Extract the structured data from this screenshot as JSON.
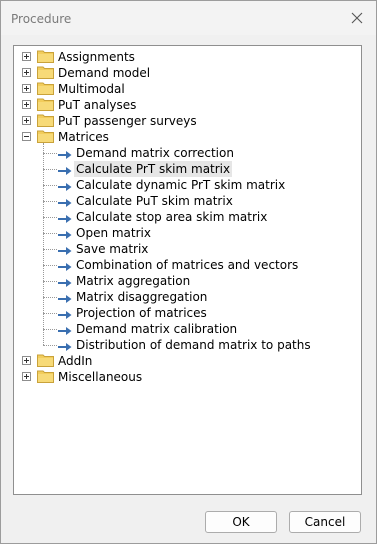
{
  "window": {
    "title": "Procedure"
  },
  "tree": {
    "folders_top": [
      "Assignments",
      "Demand model",
      "Multimodal",
      "PuT analyses",
      "PuT passenger surveys"
    ],
    "expanded_folder": "Matrices",
    "children": [
      "Demand matrix correction",
      "Calculate PrT skim matrix",
      "Calculate dynamic PrT skim matrix",
      "Calculate PuT skim matrix",
      "Calculate stop area skim matrix",
      "Open matrix",
      "Save matrix",
      "Combination of matrices and vectors",
      "Matrix aggregation",
      "Matrix disaggregation",
      "Projection of matrices",
      "Demand matrix calibration",
      "Distribution of demand matrix to paths"
    ],
    "selected_child": "Calculate PrT skim matrix",
    "folders_bottom": [
      "AddIn",
      "Miscellaneous"
    ]
  },
  "buttons": {
    "ok": "OK",
    "cancel": "Cancel"
  },
  "colors": {
    "folder": "#f2cd5c",
    "arrow": "#3a6fb0",
    "selection": "#e6e6e6"
  },
  "icons": {
    "folder": "folder-icon",
    "procedure": "arrow-right-icon",
    "close": "close-icon"
  }
}
